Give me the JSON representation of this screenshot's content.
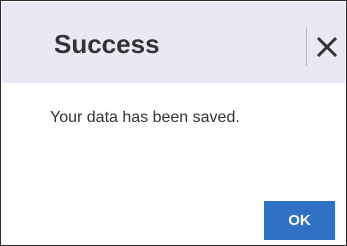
{
  "dialog": {
    "title": "Success",
    "message": "Your data has been saved.",
    "ok_label": "OK",
    "close_icon": "close-icon"
  },
  "colors": {
    "header_bg": "#e9e9f6",
    "ok_button_bg": "#2f72c5",
    "text": "#333333",
    "border": "#2b2b2b"
  }
}
